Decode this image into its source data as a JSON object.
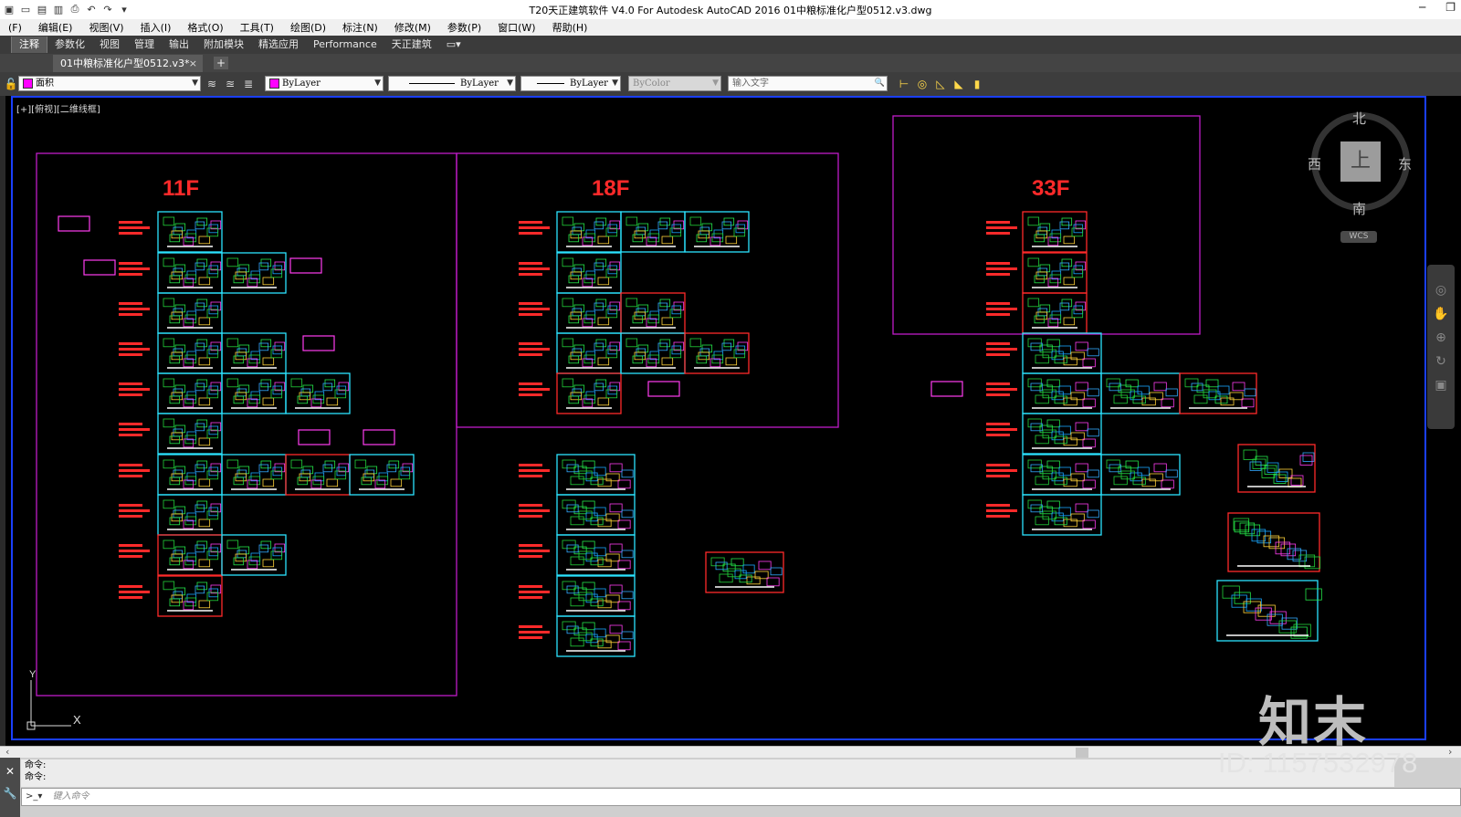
{
  "window": {
    "title": "T20天正建筑软件 V4.0 For Autodesk AutoCAD 2016    01中粮标准化户型0512.v3.dwg",
    "controls": [
      "─",
      "❐"
    ]
  },
  "menubar": {
    "items": [
      "(F)",
      "编辑(E)",
      "视图(V)",
      "插入(I)",
      "格式(O)",
      "工具(T)",
      "绘图(D)",
      "标注(N)",
      "修改(M)",
      "参数(P)",
      "窗口(W)",
      "帮助(H)"
    ]
  },
  "ribbon": {
    "tabs": [
      "注释",
      "参数化",
      "视图",
      "管理",
      "输出",
      "附加模块",
      "精选应用",
      "Performance",
      "天正建筑"
    ],
    "active": "注释"
  },
  "doc_tabs": {
    "active_tab": "01中粮标准化户型0512.v3*",
    "close": "×",
    "new_tab": "+"
  },
  "properties": {
    "layer": "面积",
    "layer_color": "#ff00ff",
    "color": "ByLayer",
    "linetype": "ByLayer",
    "lineweight": "ByLayer",
    "plotstyle": "ByColor",
    "search_placeholder": "输入文字"
  },
  "canvas": {
    "view_label": "[+][俯视][二维线框]",
    "bg": "#000000",
    "sections": [
      "11F",
      "18F",
      "33F"
    ]
  },
  "viewcube": {
    "north": "北",
    "south": "南",
    "east": "东",
    "west": "西",
    "face": "上",
    "wcs": "WCS"
  },
  "ucs": {
    "y": "Y",
    "x": "X"
  },
  "command": {
    "history": [
      "命令:",
      "命令:"
    ],
    "placeholder": "键入命令"
  },
  "watermark": {
    "logo": "知末",
    "id": "ID: 1157532978"
  }
}
